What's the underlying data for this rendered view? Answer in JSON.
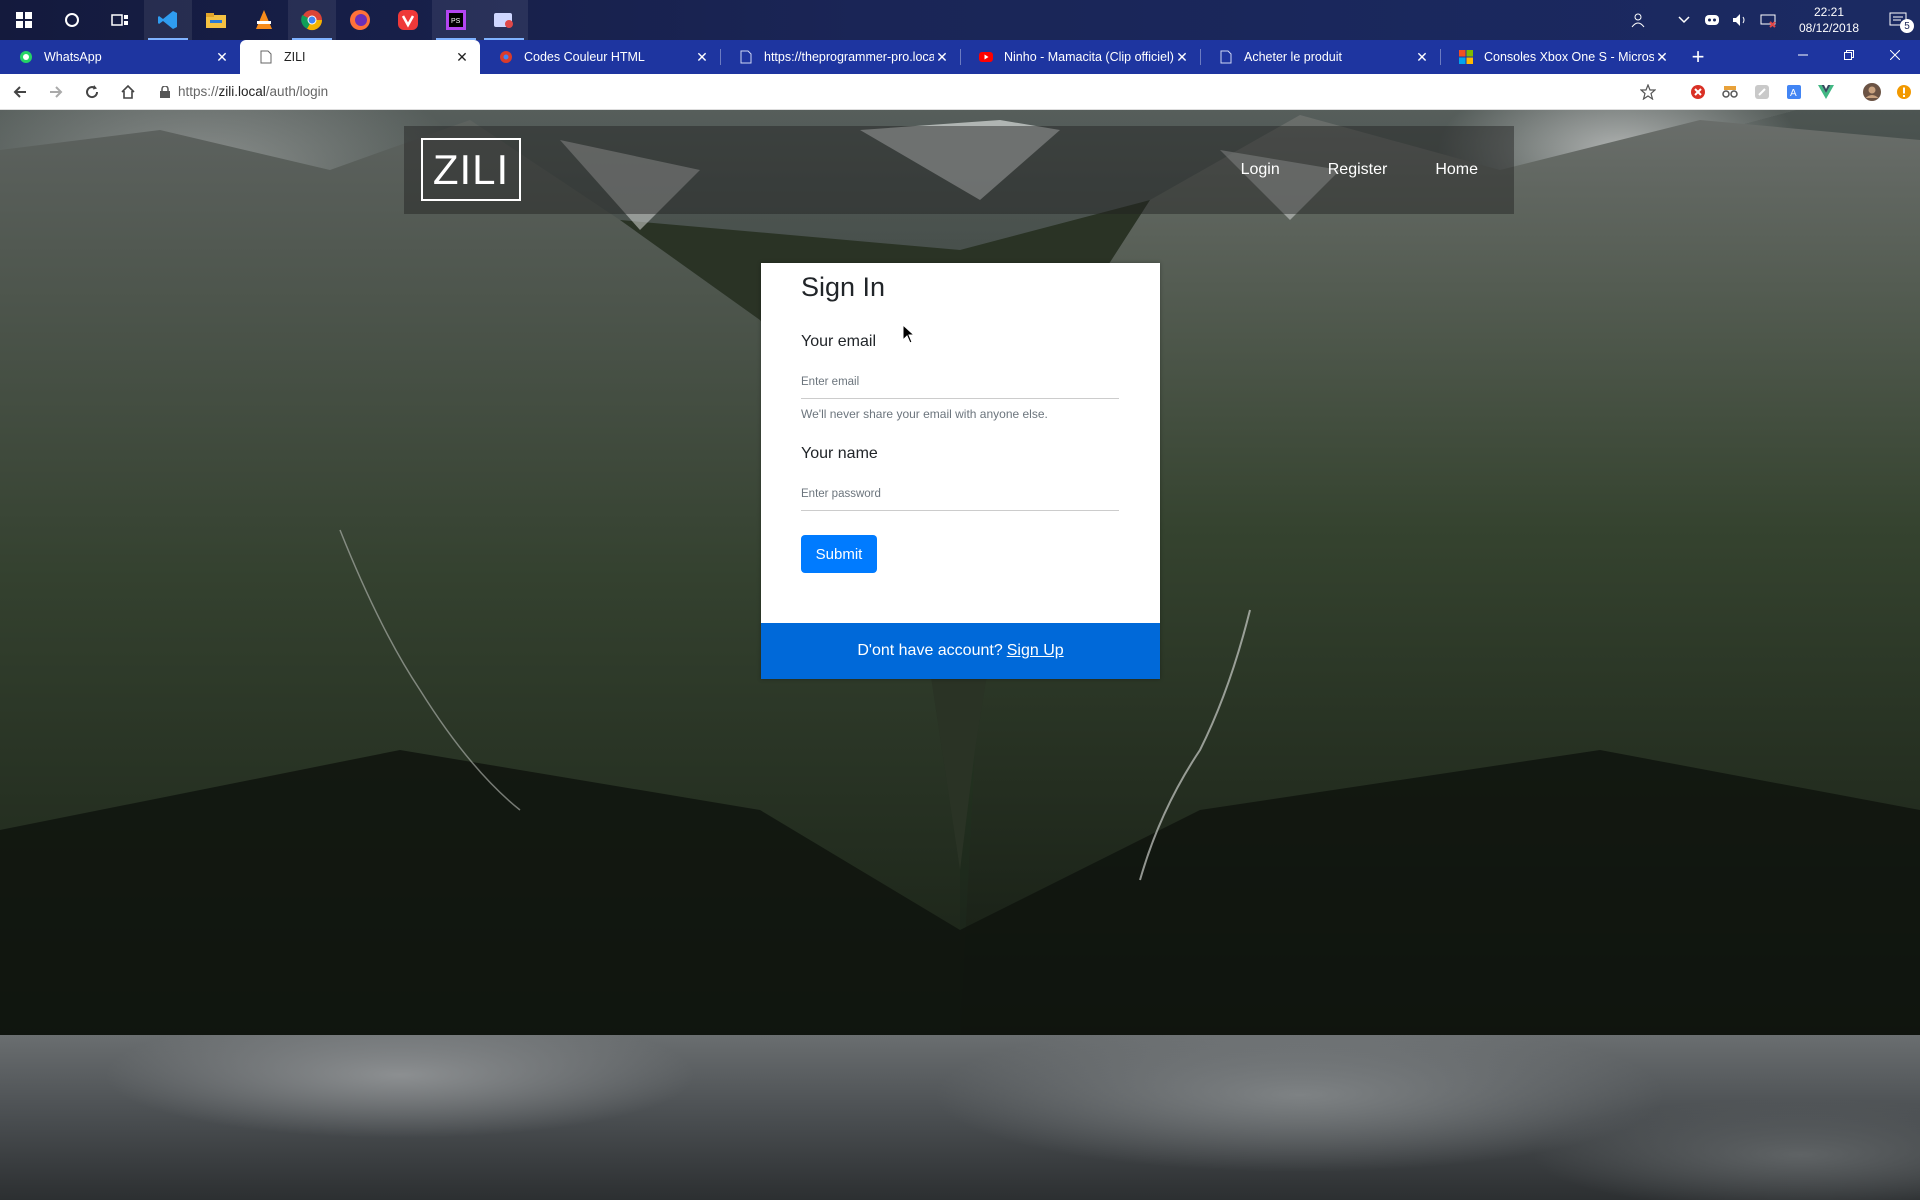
{
  "taskbar": {
    "apps": [
      "windows-start",
      "cortana",
      "task-view",
      "vscode",
      "file-explorer",
      "vlc",
      "chrome",
      "firefox",
      "vivaldi",
      "phpstorm",
      "snip"
    ],
    "clock_time": "22:21",
    "clock_date": "08/12/2018",
    "notification_count": "5"
  },
  "browser": {
    "tabs": [
      {
        "title": "WhatsApp",
        "icon": "whatsapp-icon"
      },
      {
        "title": "ZILI",
        "icon": "page-icon"
      },
      {
        "title": "Codes Couleur HTML",
        "icon": "chrome-icon"
      },
      {
        "title": "https://theprogrammer-pro.local",
        "icon": "page-icon"
      },
      {
        "title": "Ninho - Mamacita (Clip officiel) -",
        "icon": "youtube-icon"
      },
      {
        "title": "Acheter le produit",
        "icon": "page-icon"
      },
      {
        "title": "Consoles Xbox One S - Microsoft",
        "icon": "microsoft-icon"
      }
    ],
    "url_scheme": "https://",
    "url_host": "zili.local",
    "url_path": "/auth/login"
  },
  "site": {
    "brand": "ZILI",
    "nav": {
      "login": "Login",
      "register": "Register",
      "home": "Home"
    }
  },
  "form": {
    "title": "Sign In",
    "email_label": "Your email",
    "email_placeholder": "Enter email",
    "email_help": "We'll never share your email with anyone else.",
    "name_label": "Your name",
    "password_placeholder": "Enter password",
    "submit_label": "Submit",
    "footer_text": "D'ont have account?",
    "footer_link": "Sign Up"
  },
  "colors": {
    "primary": "#007bff",
    "footer": "#0069d9",
    "tabstrip": "#1e35a0"
  }
}
